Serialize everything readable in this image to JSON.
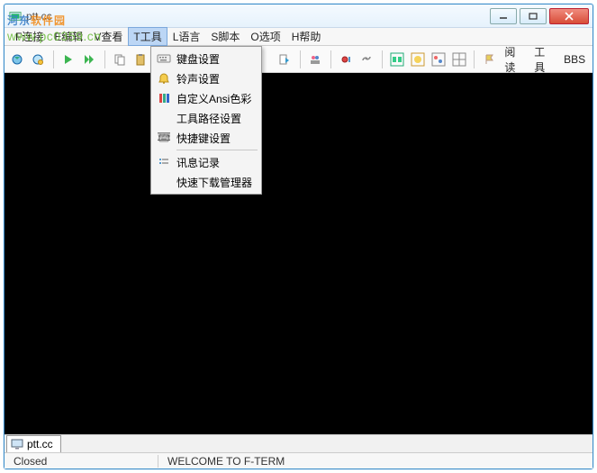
{
  "watermark": {
    "brand_a": "河东",
    "brand_b": "软件园",
    "url": "www.pc0359.cn"
  },
  "title": "ptt.cc",
  "menu": {
    "f": "F连接",
    "e": "E编辑",
    "v": "V查看",
    "t": "T工具",
    "l": "L语言",
    "s": "S脚本",
    "o": "O选项",
    "h": "H帮助"
  },
  "dropdown": {
    "keyboard": "键盘设置",
    "bell": "铃声设置",
    "ansi": "自定义Ansi色彩",
    "toolpath": "工具路径设置",
    "shortcut": "快捷键设置",
    "msglog": "讯息记录",
    "fastdl": "快速下载管理器"
  },
  "toolbar_labels": {
    "read": "阅读",
    "tool": "工具",
    "bbs": "BBS"
  },
  "tab": "ptt.cc",
  "status": {
    "left": "Closed",
    "center": "WELCOME TO F-TERM"
  }
}
